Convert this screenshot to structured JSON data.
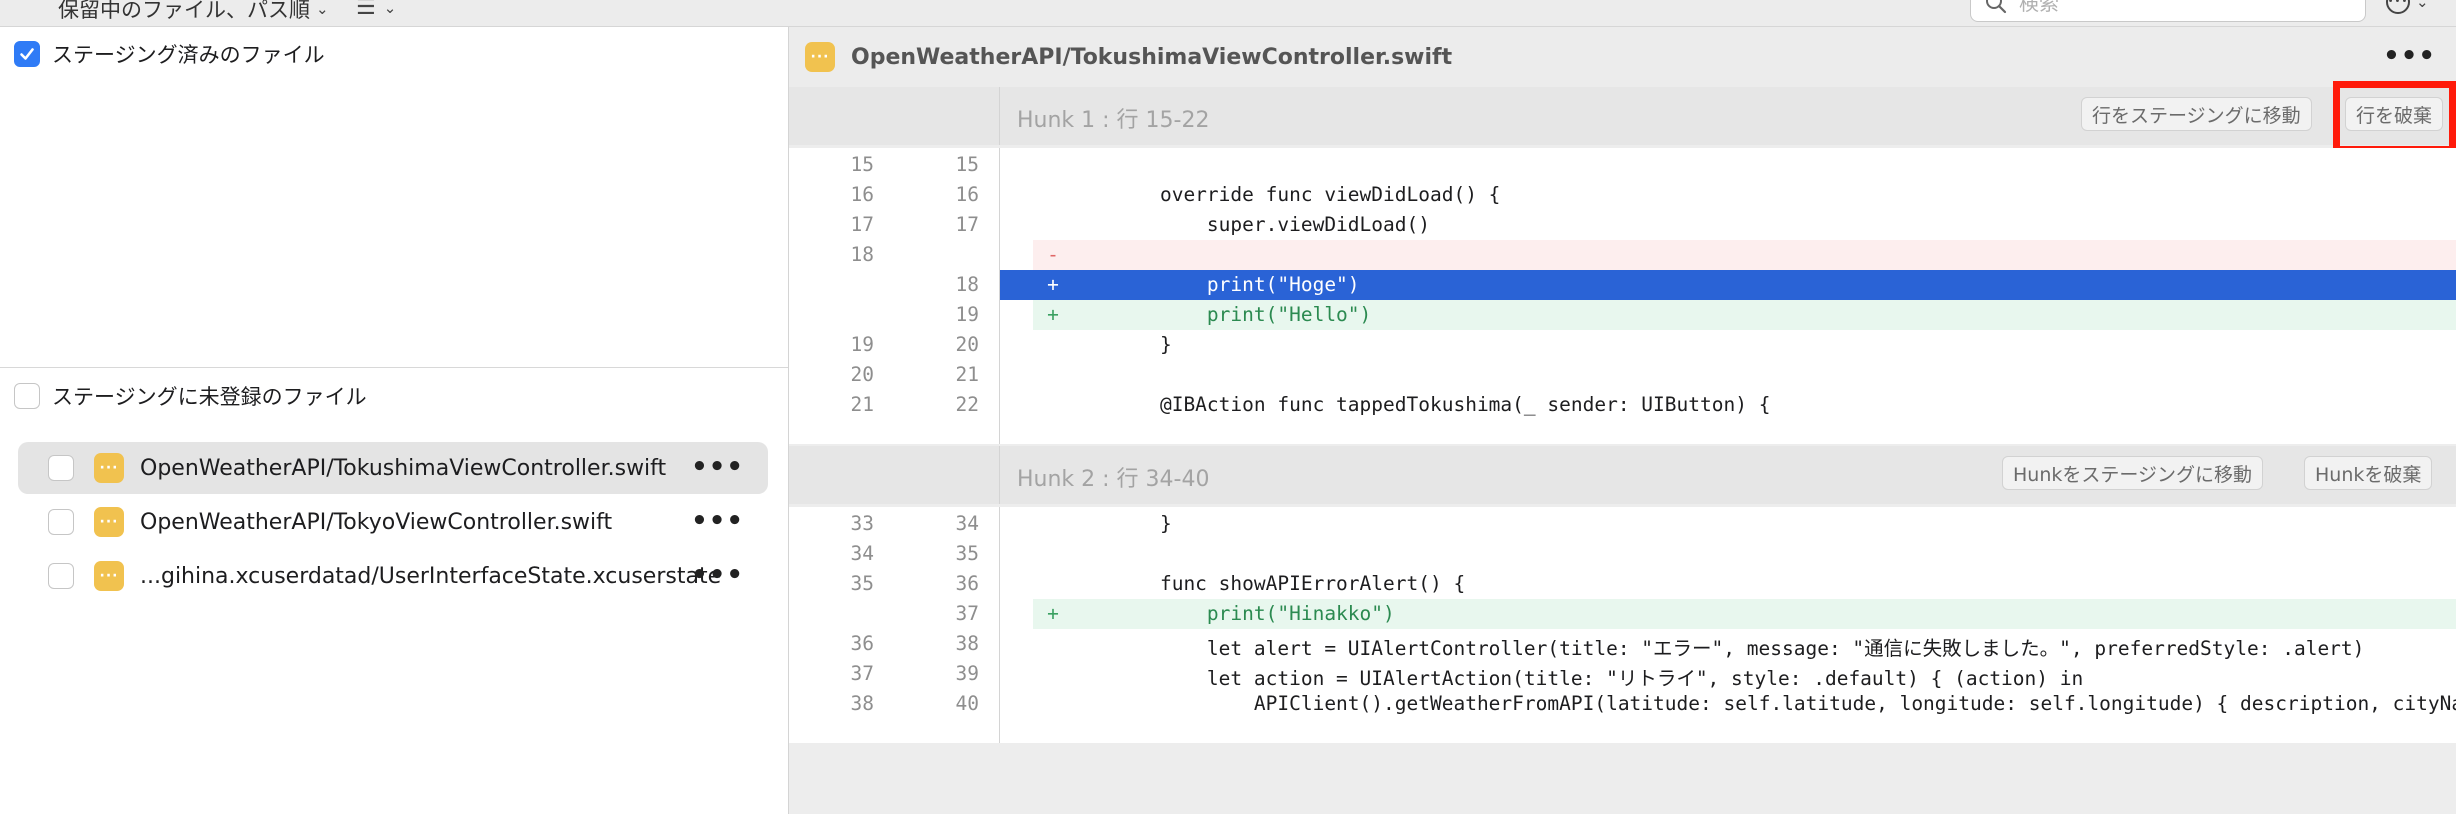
{
  "toolbar": {
    "sort_label": "保留中のファイル、パス順",
    "view_icon": "list-icon",
    "search_placeholder": "検索",
    "more_icon": "ellipsis-circle-icon"
  },
  "left": {
    "staged": {
      "label": "ステージング済みのファイル",
      "checked": true
    },
    "unstaged": {
      "label": "ステージングに未登録のファイル",
      "checked": false,
      "files": [
        {
          "name": "OpenWeatherAPI/TokushimaViewController.swift",
          "selected": true
        },
        {
          "name": "OpenWeatherAPI/TokyoViewController.swift",
          "selected": false
        },
        {
          "name": "...gihina.xcuserdatad/UserInterfaceState.xcuserstate",
          "selected": false
        }
      ]
    }
  },
  "diff": {
    "file_path": "OpenWeatherAPI/TokushimaViewController.swift",
    "hunks": [
      {
        "title": "Hunk 1 : 行 15-22",
        "buttons": [
          "行をステージングに移動",
          "行を破棄"
        ],
        "lines": [
          {
            "old": "15",
            "new": "15",
            "type": "ctx",
            "marker": "",
            "text": ""
          },
          {
            "old": "16",
            "new": "16",
            "type": "ctx",
            "marker": "",
            "text": "    override func viewDidLoad() {"
          },
          {
            "old": "17",
            "new": "17",
            "type": "ctx",
            "marker": "",
            "text": "        super.viewDidLoad()"
          },
          {
            "old": "18",
            "new": "",
            "type": "del",
            "marker": "-",
            "text": ""
          },
          {
            "old": "",
            "new": "18",
            "type": "sel",
            "marker": "+",
            "text": "        print(\"Hoge\")"
          },
          {
            "old": "",
            "new": "19",
            "type": "add",
            "marker": "+",
            "text": "        print(\"Hello\")"
          },
          {
            "old": "19",
            "new": "20",
            "type": "ctx",
            "marker": "",
            "text": "    }"
          },
          {
            "old": "20",
            "new": "21",
            "type": "ctx",
            "marker": "",
            "text": ""
          },
          {
            "old": "21",
            "new": "22",
            "type": "ctx",
            "marker": "",
            "text": "    @IBAction func tappedTokushima(_ sender: UIButton) {"
          }
        ]
      },
      {
        "title": "Hunk 2 : 行 34-40",
        "buttons": [
          "Hunkをステージングに移動",
          "Hunkを破棄"
        ],
        "lines": [
          {
            "old": "33",
            "new": "34",
            "type": "ctx",
            "marker": "",
            "text": "    }"
          },
          {
            "old": "34",
            "new": "35",
            "type": "ctx",
            "marker": "",
            "text": ""
          },
          {
            "old": "35",
            "new": "36",
            "type": "ctx",
            "marker": "",
            "text": "    func showAPIErrorAlert() {"
          },
          {
            "old": "",
            "new": "37",
            "type": "add",
            "marker": "+",
            "text": "        print(\"Hinakko\")"
          },
          {
            "old": "36",
            "new": "38",
            "type": "ctx",
            "marker": "",
            "text": "        let alert = UIAlertController(title: \"エラー\", message: \"通信に失敗しました。\", preferredStyle: .alert)"
          },
          {
            "old": "37",
            "new": "39",
            "type": "ctx",
            "marker": "",
            "text": "        let action = UIAlertAction(title: \"リトライ\", style: .default) { (action) in"
          },
          {
            "old": "38",
            "new": "40",
            "type": "ctx",
            "marker": "",
            "text": "            APIClient().getWeatherFromAPI(latitude: self.latitude, longitude: self.longitude) { description, cityName"
          }
        ]
      }
    ]
  },
  "colors": {
    "selection": "#2a63d6",
    "added_bg": "#e8f7ee",
    "removed_bg": "#fdeeee",
    "highlight": "#ff1a0a",
    "file_badge": "#f1c24f",
    "checkbox_on": "#2f7bf6"
  }
}
